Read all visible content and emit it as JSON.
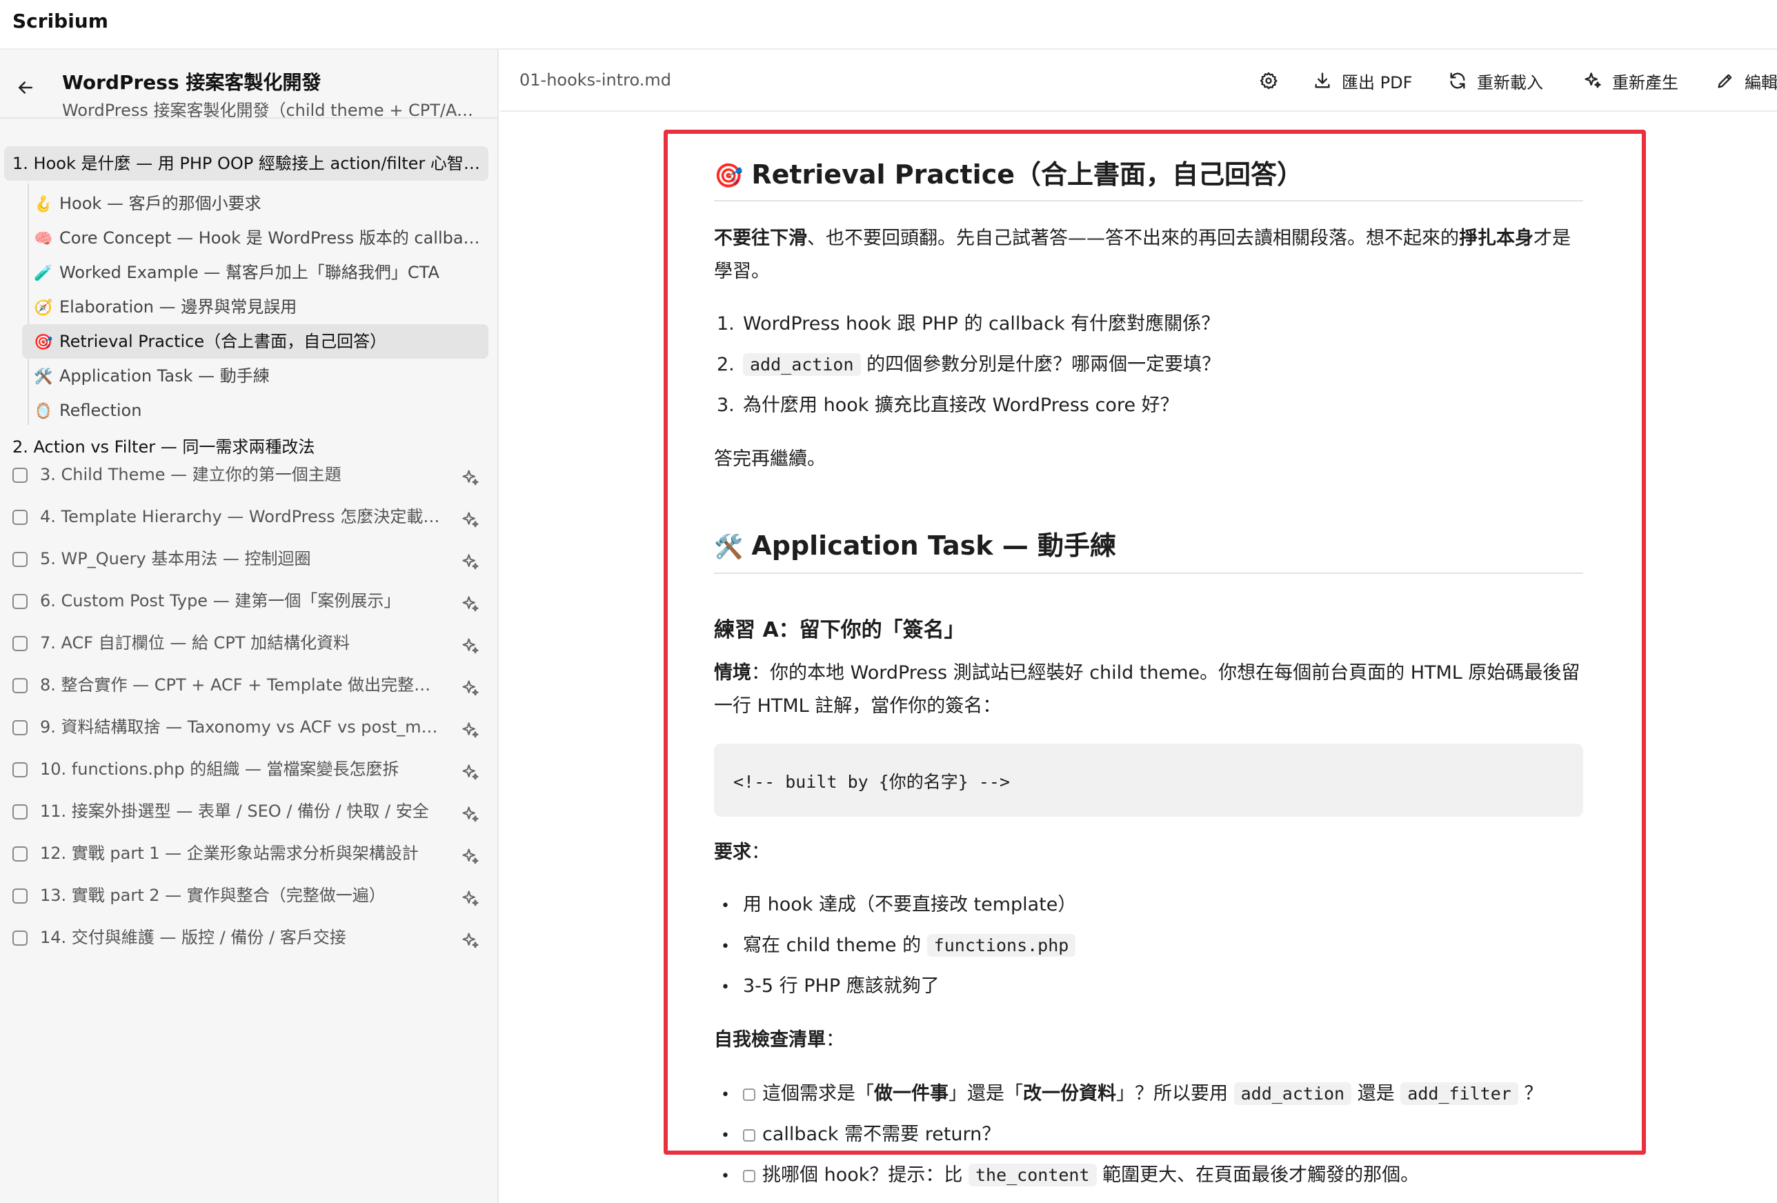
{
  "app": {
    "title": "Scribium"
  },
  "sidebar": {
    "title": "WordPress 接案客製化開發",
    "subtitle": "WordPress 接案客製化開發（child theme + CPT/ACF…",
    "chapter1": "1. Hook 是什麼 — 用 PHP OOP 經驗接上 action/filter 心智…",
    "sections": [
      {
        "icon": "🪝",
        "label": "Hook — 客戶的那個小要求"
      },
      {
        "icon": "🧠",
        "label": "Core Concept — Hook 是 WordPress 版本的 callba…"
      },
      {
        "icon": "🧪",
        "label": "Worked Example — 幫客戶加上「聯絡我們」CTA"
      },
      {
        "icon": "🧭",
        "label": "Elaboration — 邊界與常見誤用"
      },
      {
        "icon": "🎯",
        "label": "Retrieval Practice（合上書面，自己回答）"
      },
      {
        "icon": "🛠️",
        "label": "Application Task — 動手練"
      },
      {
        "icon": "🪞",
        "label": "Reflection"
      }
    ],
    "chapter2": "2. Action vs Filter — 同一需求兩種改法",
    "chapters": [
      "3. Child Theme — 建立你的第一個主題",
      "4. Template Hierarchy — WordPress 怎麼決定載…",
      "5. WP_Query 基本用法 — 控制迴圈",
      "6. Custom Post Type — 建第一個「案例展示」",
      "7. ACF 自訂欄位 — 給 CPT 加結構化資料",
      "8. 整合實作 — CPT + ACF + Template 做出完整「…",
      "9. 資料結構取捨 — Taxonomy vs ACF vs post_meta",
      "10. functions.php 的組織 — 當檔案變長怎麼拆",
      "11. 接案外掛選型 — 表單 / SEO / 備份 / 快取 / 安全",
      "12. 實戰 part 1 — 企業形象站需求分析與架構設計",
      "13. 實戰 part 2 — 實作與整合（完整做一遍）",
      "14. 交付與維護 — 版控 / 備份 / 客戶交接"
    ]
  },
  "toolbar": {
    "file": "01-hooks-intro.md",
    "export_pdf": "匯出 PDF",
    "reload": "重新載入",
    "regenerate": "重新產生",
    "edit": "編輯"
  },
  "doc": {
    "retrieval": {
      "emoji": "🎯",
      "heading": "Retrieval Practice（合上書面，自己回答）",
      "intro_bold": "不要往下滑",
      "intro_mid": "、也不要回頭翻。先自己試著答——答不出來的再回去讀相關段落。想不起來的",
      "intro_bold2": "掙扎本身",
      "intro_end": "才是學習。",
      "q1": "WordPress hook 跟 PHP 的 callback 有什麼對應關係？",
      "q2_code": "add_action",
      "q2_text": "的四個參數分別是什麼？哪兩個一定要填？",
      "q3": "為什麼用 hook 擴充比直接改 WordPress core 好？",
      "outro": "答完再繼續。"
    },
    "application": {
      "emoji": "🛠️",
      "heading": "Application Task — 動手練",
      "exercise_title": "練習 A：留下你的「簽名」",
      "scenario_label": "情境",
      "scenario_text": "：你的本地 WordPress 測試站已經裝好 child theme。你想在每個前台頁面的 HTML 原始碼最後留一行 HTML 註解，當作你的簽名：",
      "code": "<!-- built by {你的名字} -->",
      "req_label": "要求",
      "req_colon": "：",
      "req1": "用 hook 達成（不要直接改 template）",
      "req2_pre": "寫在 child theme 的",
      "req2_code": "functions.php",
      "req3": "3-5 行 PHP 應該就夠了",
      "check_label": "自我檢查清單",
      "check_colon": "：",
      "c1_a": "這個需求是「",
      "c1_b": "做一件事",
      "c1_c": "」還是「",
      "c1_d": "改一份資料",
      "c1_e": "」？所以要用",
      "c1_code1": "add_action",
      "c1_f": "還是",
      "c1_code2": "add_filter",
      "c1_g": "？",
      "c2": "callback 需不需要 return？",
      "c3_pre": "挑哪個 hook？提示：比",
      "c3_code": "the_content",
      "c3_post": "範圍更大、在頁面最後才觸發的那個。"
    }
  },
  "colors": {
    "highlight": "#e8303f",
    "sidebar_bg": "#f6f6f6",
    "active_bg": "#e4e4e4"
  }
}
